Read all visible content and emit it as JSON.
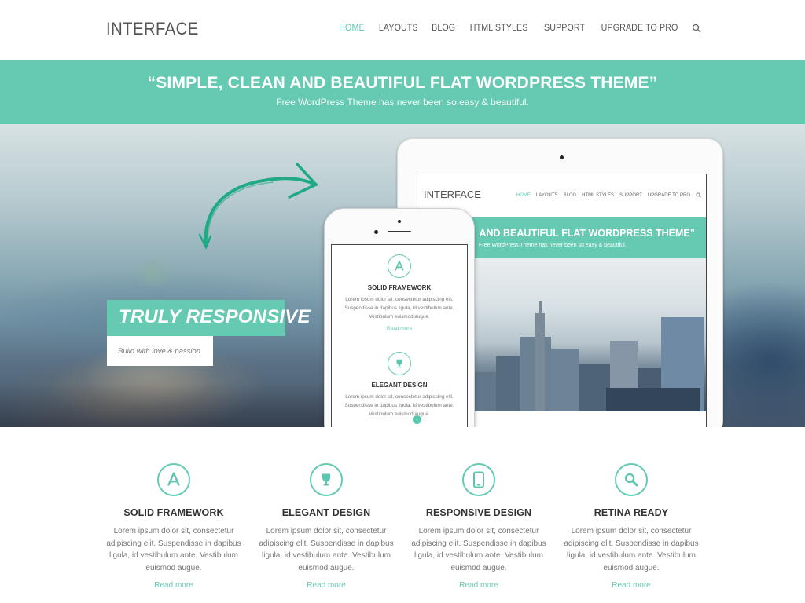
{
  "header": {
    "logo": "INTERFACE",
    "nav": [
      {
        "label": "HOME",
        "active": true
      },
      {
        "label": "LAYOUTS",
        "active": false
      },
      {
        "label": "BLOG",
        "active": false
      },
      {
        "label": "HTML STYLES",
        "active": false
      },
      {
        "label": "SUPPORT",
        "active": false
      },
      {
        "label": "UPGRADE TO PRO",
        "active": false
      }
    ],
    "search_icon": "search-icon"
  },
  "banner": {
    "title": "“SIMPLE, CLEAN AND BEAUTIFUL FLAT WORDPRESS THEME”",
    "subtitle": "Free WordPress Theme has never been so easy & beautiful."
  },
  "hero": {
    "tagline": "TRULY RESPONSIVE",
    "subtag": "Build with love & passion",
    "tablet": {
      "logo": "INTERFACE",
      "nav": [
        "HOME",
        "LAYOUTS",
        "BLOG",
        "HTML STYLES",
        "SUPPORT",
        "UPGRADE TO PRO"
      ],
      "banner_title": "AND BEAUTIFUL FLAT WORDPRESS THEME”",
      "banner_subtitle": "Free WordPress Theme has never been so easy & beautiful."
    },
    "phone": {
      "features": [
        {
          "title": "SOLID FRAMEWORK",
          "text": "Lorem ipsum dolor sit, consectetur adipiscing elit. Suspendisse in dapibus ligula, id vestibulum ante. Vestibulum euismod augue.",
          "link": "Read more",
          "icon": "app-store-icon"
        },
        {
          "title": "ELEGANT DESIGN",
          "text": "Lorem ipsum dolor sit, consectetur adipiscing elit. Suspendisse in dapibus ligula, id vestibulum ante. Vestibulum euismod augue.",
          "icon": "trophy-icon"
        }
      ],
      "pager": {
        "pages": 2,
        "current": 2
      }
    }
  },
  "features": [
    {
      "title": "SOLID FRAMEWORK",
      "text": "Lorem ipsum dolor sit, consectetur adipiscing elit. Suspendisse in dapibus ligula, id vestibulum ante. Vestibulum euismod augue.",
      "link": "Read more",
      "icon": "app-store-icon"
    },
    {
      "title": "ELEGANT DESIGN",
      "text": "Lorem ipsum dolor sit, consectetur adipiscing elit. Suspendisse in dapibus ligula, id vestibulum ante. Vestibulum euismod augue.",
      "link": "Read more",
      "icon": "trophy-icon"
    },
    {
      "title": "RESPONSIVE DESIGN",
      "text": "Lorem ipsum dolor sit, consectetur adipiscing elit. Suspendisse in dapibus ligula, id vestibulum ante. Vestibulum euismod augue.",
      "link": "Read more",
      "icon": "mobile-icon"
    },
    {
      "title": "RETINA READY",
      "text": "Lorem ipsum dolor sit, consectetur adipiscing elit. Suspendisse in dapibus ligula, id vestibulum ante. Vestibulum euismod augue.",
      "link": "Read more",
      "icon": "magnifier-icon"
    }
  ],
  "colors": {
    "accent": "#66c9b2",
    "nav_active": "#5cc6ae",
    "heading": "#333333",
    "body_text": "#777777"
  }
}
